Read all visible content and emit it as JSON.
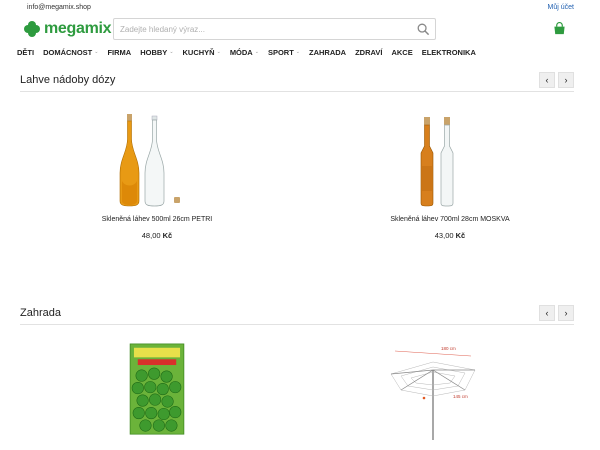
{
  "header": {
    "email": "info@megamix.shop",
    "account": "Můj účet",
    "logo": "megamix",
    "search_placeholder": "Zadejte hledaný výraz..."
  },
  "nav": [
    {
      "label": "DĚTI",
      "dropdown": false
    },
    {
      "label": "DOMÁCNOST",
      "dropdown": true
    },
    {
      "label": "FIRMA",
      "dropdown": false
    },
    {
      "label": "HOBBY",
      "dropdown": true
    },
    {
      "label": "KUCHYŇ",
      "dropdown": true
    },
    {
      "label": "MÓDA",
      "dropdown": true
    },
    {
      "label": "SPORT",
      "dropdown": true
    },
    {
      "label": "ZAHRADA",
      "dropdown": false
    },
    {
      "label": "ZDRAVÍ",
      "dropdown": false
    },
    {
      "label": "AKCE",
      "dropdown": false
    },
    {
      "label": "ELEKTRONIKA",
      "dropdown": false
    }
  ],
  "sections": [
    {
      "title": "Lahve nádoby dózy",
      "products": [
        {
          "name": "Skleněná láhev 500ml 26cm PETRI",
          "price": "48,00",
          "currency": "Kč",
          "image": "bottle-petri-image"
        },
        {
          "name": "Skleněná láhev 700ml 28cm MOSKVA",
          "price": "43,00",
          "currency": "Kč",
          "image": "bottle-moskva-image"
        }
      ]
    },
    {
      "title": "Zahrada",
      "products": [
        {
          "name": "",
          "price": "",
          "currency": "",
          "image": "garden-packet-image"
        },
        {
          "name": "",
          "price": "",
          "currency": "",
          "image": "clothes-dryer-image"
        }
      ]
    }
  ],
  "dryer_labels": [
    "180 cm",
    "145 cm"
  ],
  "colors": {
    "brand": "#2e9b3f",
    "link": "#1f5fb0"
  }
}
